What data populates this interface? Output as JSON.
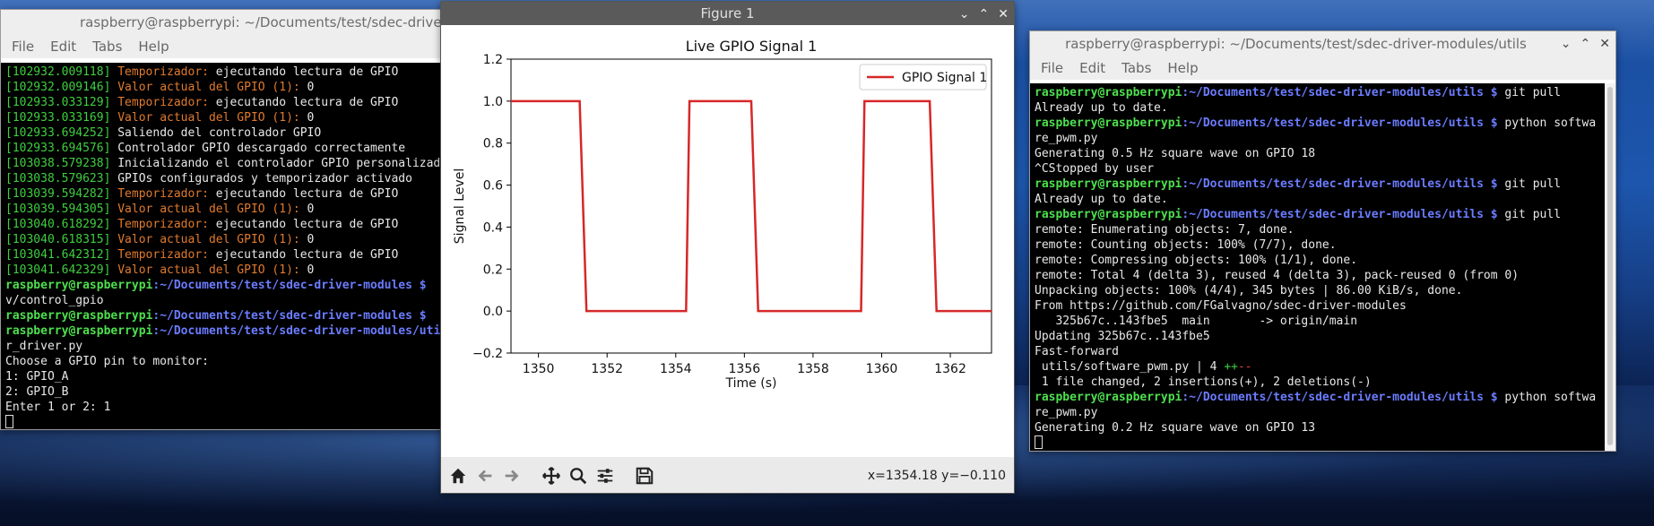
{
  "left_terminal": {
    "title": "raspberry@raspberrypi: ~/Documents/test/sdec-driver-modules",
    "menu": [
      "File",
      "Edit",
      "Tabs",
      "Help"
    ],
    "lines": [
      {
        "ts": "[102932.009118]",
        "label": "Temporizador:",
        "text": " ejecutando lectura de GPIO"
      },
      {
        "ts": "[102932.009146]",
        "label": "Valor actual del GPIO (1):",
        "text": " 0"
      },
      {
        "ts": "[102933.033129]",
        "label": "Temporizador:",
        "text": " ejecutando lectura de GPIO"
      },
      {
        "ts": "[102933.033169]",
        "label": "Valor actual del GPIO (1):",
        "text": " 0"
      },
      {
        "ts": "[102933.694252]",
        "label": "",
        "text": " Saliendo del controlador GPIO"
      },
      {
        "ts": "[102933.694576]",
        "label": "",
        "text": " Controlador GPIO descargado correctamente"
      },
      {
        "ts": "[103038.579238]",
        "label": "",
        "text": " Inicializando el controlador GPIO personalizado"
      },
      {
        "ts": "[103038.579623]",
        "label": "",
        "text": " GPIOs configurados y temporizador activado"
      },
      {
        "ts": "[103039.594282]",
        "label": "Temporizador:",
        "text": " ejecutando lectura de GPIO"
      },
      {
        "ts": "[103039.594305]",
        "label": "Valor actual del GPIO (1):",
        "text": " 0"
      },
      {
        "ts": "[103040.618292]",
        "label": "Temporizador:",
        "text": " ejecutando lectura de GPIO"
      },
      {
        "ts": "[103040.618315]",
        "label": "Valor actual del GPIO (1):",
        "text": " 0"
      },
      {
        "ts": "[103041.642312]",
        "label": "Temporizador:",
        "text": " ejecutando lectura de GPIO"
      },
      {
        "ts": "[103041.642329]",
        "label": "Valor actual del GPIO (1):",
        "text": " 0"
      }
    ],
    "prompt_user": "raspberry@raspberrypi",
    "prompt_path_1": ":~/Documents/test/sdec-driver-modules $",
    "wrap_1": "v/control_gpio",
    "prompt_path_2": ":~/Documents/test/sdec-driver-modules $",
    "prompt_path_3": ":~/Documents/test/sdec-driver-modules/utils",
    "wrap_3": "r_driver.py",
    "out_1": "Choose a GPIO pin to monitor:",
    "out_2": "1: GPIO_A",
    "out_3": "2: GPIO_B",
    "out_4": "Enter 1 or 2: 1"
  },
  "figure": {
    "window_title": "Figure 1",
    "plot_title": "Live GPIO Signal 1",
    "xlabel": "Time (s)",
    "ylabel": "Signal Level",
    "legend": "GPIO Signal 1",
    "coords": "x=1354.18 y=−0.110",
    "line_color": "#d62728"
  },
  "chart_data": {
    "type": "line",
    "title": "Live GPIO Signal 1",
    "xlabel": "Time (s)",
    "ylabel": "Signal Level",
    "xlim": [
      1349.2,
      1363.2
    ],
    "ylim": [
      -0.2,
      1.2
    ],
    "x_ticks": [
      1350,
      1352,
      1354,
      1356,
      1358,
      1360,
      1362
    ],
    "y_ticks": [
      -0.2,
      0.0,
      0.2,
      0.4,
      0.6,
      0.8,
      1.0,
      1.2
    ],
    "y_tick_labels": [
      "−0.2",
      "0.0",
      "0.2",
      "0.4",
      "0.6",
      "0.8",
      "1.0",
      "1.2"
    ],
    "legend_position": "upper right",
    "grid": false,
    "series": [
      {
        "name": "GPIO Signal 1",
        "color": "#d62728",
        "x": [
          1349.2,
          1351.2,
          1351.4,
          1354.3,
          1354.4,
          1356.2,
          1356.4,
          1359.4,
          1359.5,
          1361.4,
          1361.6,
          1363.2
        ],
        "y": [
          1,
          1,
          0,
          0,
          1,
          1,
          0,
          0,
          1,
          1,
          0,
          0
        ]
      }
    ]
  },
  "right_terminal": {
    "title": "raspberry@raspberrypi: ~/Documents/test/sdec-driver-modules/utils",
    "menu": [
      "File",
      "Edit",
      "Tabs",
      "Help"
    ],
    "prompt_user": "raspberry@raspberrypi",
    "prompt_path": ":~/Documents/test/sdec-driver-modules/utils $",
    "lines": [
      {
        "kind": "prompt",
        "text": " git pull"
      },
      {
        "kind": "out",
        "text": "Already up to date."
      },
      {
        "kind": "prompt",
        "text": " python softwa"
      },
      {
        "kind": "out",
        "text": "re_pwm.py"
      },
      {
        "kind": "out",
        "text": "Generating 0.5 Hz square wave on GPIO 18"
      },
      {
        "kind": "out",
        "text": "^CStopped by user"
      },
      {
        "kind": "prompt",
        "text": " git pull"
      },
      {
        "kind": "out",
        "text": "Already up to date."
      },
      {
        "kind": "prompt",
        "text": " git pull"
      },
      {
        "kind": "out",
        "text": "remote: Enumerating objects: 7, done."
      },
      {
        "kind": "out",
        "text": "remote: Counting objects: 100% (7/7), done."
      },
      {
        "kind": "out",
        "text": "remote: Compressing objects: 100% (1/1), done."
      },
      {
        "kind": "out",
        "text": "remote: Total 4 (delta 3), reused 4 (delta 3), pack-reused 0 (from 0)"
      },
      {
        "kind": "out",
        "text": "Unpacking objects: 100% (4/4), 345 bytes | 86.00 KiB/s, done."
      },
      {
        "kind": "out",
        "text": "From https://github.com/FGalvagno/sdec-driver-modules"
      },
      {
        "kind": "out",
        "text": "   325b67c..143fbe5  main       -> origin/main"
      },
      {
        "kind": "out",
        "text": "Updating 325b67c..143fbe5"
      },
      {
        "kind": "out",
        "text": "Fast-forward"
      },
      {
        "kind": "diff",
        "text": " utils/software_pwm.py | 4 ",
        "plus": "++",
        "minus": "--"
      },
      {
        "kind": "out",
        "text": " 1 file changed, 2 insertions(+), 2 deletions(-)"
      },
      {
        "kind": "prompt",
        "text": " python softwa"
      },
      {
        "kind": "out",
        "text": "re_pwm.py"
      },
      {
        "kind": "out",
        "text": "Generating 0.2 Hz square wave on GPIO 13"
      }
    ]
  }
}
